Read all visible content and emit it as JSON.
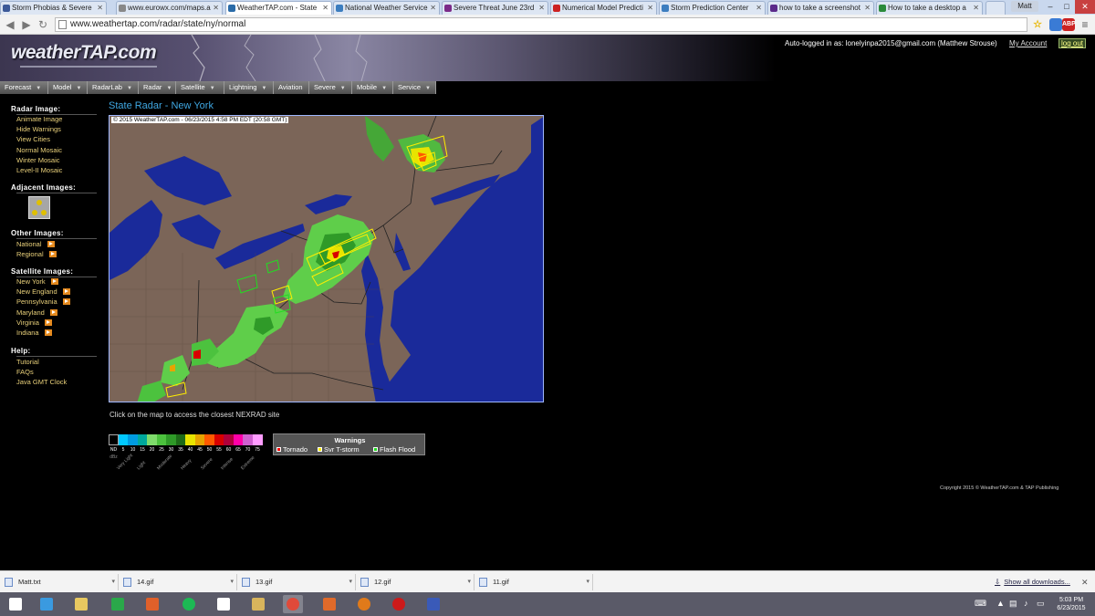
{
  "browser": {
    "tabs": [
      {
        "label": "Storm Phobias & Severe",
        "color": "#3b5998"
      },
      {
        "label": "www.eurowx.com/maps.a",
        "color": "#888888"
      },
      {
        "label": "WeatherTAP.com - State",
        "color": "#2a6ba8"
      },
      {
        "label": "National Weather Service",
        "color": "#3c7dbf"
      },
      {
        "label": "Severe Threat June 23rd",
        "color": "#7b2a88"
      },
      {
        "label": "Numerical Model Predicti",
        "color": "#cc2222"
      },
      {
        "label": "Storm Prediction Center",
        "color": "#3c7dbf"
      },
      {
        "label": "how to take a screenshot",
        "color": "#5c2a8a"
      },
      {
        "label": "How to take a desktop a",
        "color": "#2a8a3a"
      }
    ],
    "active_tab_index": 2,
    "user_chip": "Matt",
    "url": "www.weathertap.com/radar/state/ny/normal",
    "ext_icons": [
      {
        "name": "extension-icon",
        "color": "#3a7bd5",
        "text": ""
      },
      {
        "name": "adblock-icon",
        "color": "#cc2222",
        "text": "ABP"
      },
      {
        "name": "menu-icon",
        "color": "#777777",
        "text": "≡"
      }
    ]
  },
  "header": {
    "logo": "weatherTAP.com",
    "login_text": "Auto-logged in as: lonelyinpa2015@gmail.com (Matthew Strouse)",
    "my_account": "My Account",
    "logout": "log out"
  },
  "menu": [
    "Forecast",
    "Model",
    "RadarLab",
    "Radar",
    "Satellite",
    "Lightning",
    "Aviation",
    "Severe",
    "Mobile",
    "Service"
  ],
  "sidebar": {
    "radar_image": {
      "heading": "Radar Image:",
      "links": [
        "Animate Image",
        "Hide Warnings",
        "View Cities",
        "Normal Mosaic",
        "Winter Mosaic",
        "Level-II Mosaic"
      ]
    },
    "adjacent_heading": "Adjacent Images:",
    "other_images": {
      "heading": "Other Images:",
      "links": [
        "National",
        "Regional"
      ]
    },
    "satellite_images": {
      "heading": "Satellite Images:",
      "links": [
        "New York",
        "New England",
        "Pennsylvania",
        "Maryland",
        "Virginia",
        "Indiana"
      ]
    },
    "help": {
      "heading": "Help:",
      "links": [
        "Tutorial",
        "FAQs",
        "Java GMT Clock"
      ]
    }
  },
  "main": {
    "title": "State Radar - New York",
    "timestamp": "© 2015 WeatherTAP.com - 06/23/2015 4:58 PM EDT (20:58 GMT)",
    "map_note": "Click on the map to access the closest NEXRAD site"
  },
  "dbz_legend": {
    "values": [
      "ND",
      "5",
      "10",
      "15",
      "20",
      "25",
      "30",
      "35",
      "40",
      "45",
      "50",
      "55",
      "60",
      "65",
      "70",
      "75"
    ],
    "colors": [
      "#000000",
      "#00c8ff",
      "#009be0",
      "#00a89c",
      "#7fdc6c",
      "#4cc23e",
      "#2f9a28",
      "#1d6a18",
      "#e8e400",
      "#e7a400",
      "#ff5a00",
      "#d80000",
      "#b0003a",
      "#ff00a8",
      "#d060d0",
      "#ff9cff"
    ],
    "unit": "dBz",
    "words": [
      "Very Light",
      "Light",
      "Moderate",
      "Heavy",
      "Severe",
      "Intense",
      "Extreme"
    ]
  },
  "warnings": {
    "title": "Warnings",
    "items": [
      {
        "label": "Tornado",
        "color": "#ff0000"
      },
      {
        "label": "Svr T-storm",
        "color": "#ffee00"
      },
      {
        "label": "Flash Flood",
        "color": "#22dd22"
      }
    ]
  },
  "footer": {
    "copyright": "Copyright 2015 © WeatherTAP.com & TAP Publishing"
  },
  "downloads": {
    "items": [
      "Matt.txt",
      "14.gif",
      "13.gif",
      "12.gif",
      "11.gif"
    ],
    "show_all": "Show all downloads..."
  },
  "taskbar": {
    "icons": [
      {
        "name": "windows-start-icon",
        "color": "#ffffff"
      },
      {
        "name": "internet-explorer-icon",
        "color": "#3a9ae0"
      },
      {
        "name": "file-explorer-icon",
        "color": "#e8c860"
      },
      {
        "name": "store-icon",
        "color": "#2aa84a"
      },
      {
        "name": "photos-icon",
        "color": "#e0602a"
      },
      {
        "name": "spotify-icon",
        "color": "#1db954"
      },
      {
        "name": "home-icon",
        "color": "#ffffff"
      },
      {
        "name": "app-icon",
        "color": "#d8b45c"
      },
      {
        "name": "chrome-icon",
        "color": "#e04a3a"
      },
      {
        "name": "grid-app-icon",
        "color": "#e06a2a"
      },
      {
        "name": "firefox-icon",
        "color": "#e07a1a"
      },
      {
        "name": "opera-icon",
        "color": "#cc1a1a"
      },
      {
        "name": "radar-app-icon",
        "color": "#3a5ab8"
      }
    ],
    "time": "5:03 PM",
    "date": "6/23/2015"
  }
}
